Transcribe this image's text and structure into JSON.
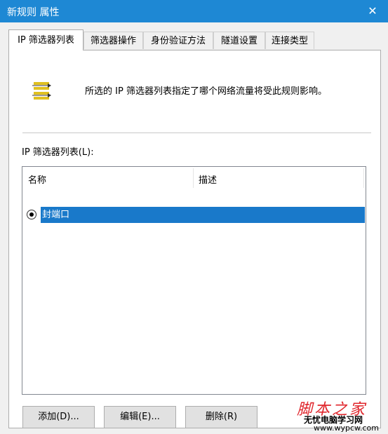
{
  "window": {
    "title": "新规则 属性",
    "close_symbol": "✕"
  },
  "tabs": [
    {
      "label": "IP 筛选器列表",
      "active": true
    },
    {
      "label": "筛选器操作"
    },
    {
      "label": "身份验证方法"
    },
    {
      "label": "隧道设置"
    },
    {
      "label": "连接类型"
    }
  ],
  "panel": {
    "icon": "filter-list-icon",
    "description": "所选的 IP 筛选器列表指定了哪个网络流量将受此规则影响。",
    "list_label": "IP 筛选器列表(L):",
    "columns": [
      "名称",
      "描述"
    ],
    "rows": [
      {
        "name": "封端口",
        "description": "",
        "selected": true
      }
    ]
  },
  "buttons": {
    "add": "添加(D)...",
    "edit": "编辑(E)...",
    "remove": "删除(R)"
  },
  "watermark": {
    "logo": "脚本之家",
    "line1": "无忧电脑学习网",
    "line2": "www.wypcw.com"
  },
  "colors": {
    "titlebar": "#1e88d4",
    "selection": "#1979ca",
    "watermark": "#e0262c"
  }
}
